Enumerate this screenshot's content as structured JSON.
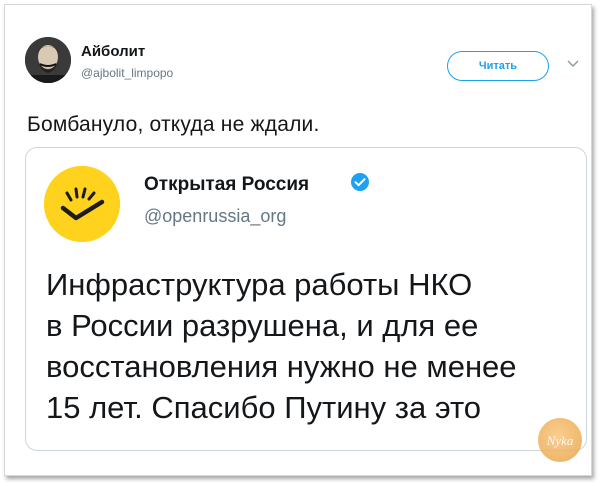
{
  "tweet": {
    "author_name": "Айболит",
    "author_handle": "@ajbolit_limpopo",
    "follow_label": "Читать",
    "text": "Бомбануло, откуда не ждали."
  },
  "quoted": {
    "name": "Открытая Россия",
    "handle": "@openrussia_org",
    "verified": true,
    "lines": [
      "Инфраструктура работы НКО",
      "в России разрушена, и для ее",
      "восстановления нужно не менее",
      "15 лет. Спасибо Путину за это"
    ]
  },
  "watermark": {
    "label": "Nyka"
  },
  "colors": {
    "accent": "#1da1f2",
    "brand_yellow": "#ffd21e",
    "text": "#14171a",
    "muted": "#657786"
  },
  "icons": {
    "verified": "verified-badge-icon",
    "caret": "chevron-down-icon"
  }
}
